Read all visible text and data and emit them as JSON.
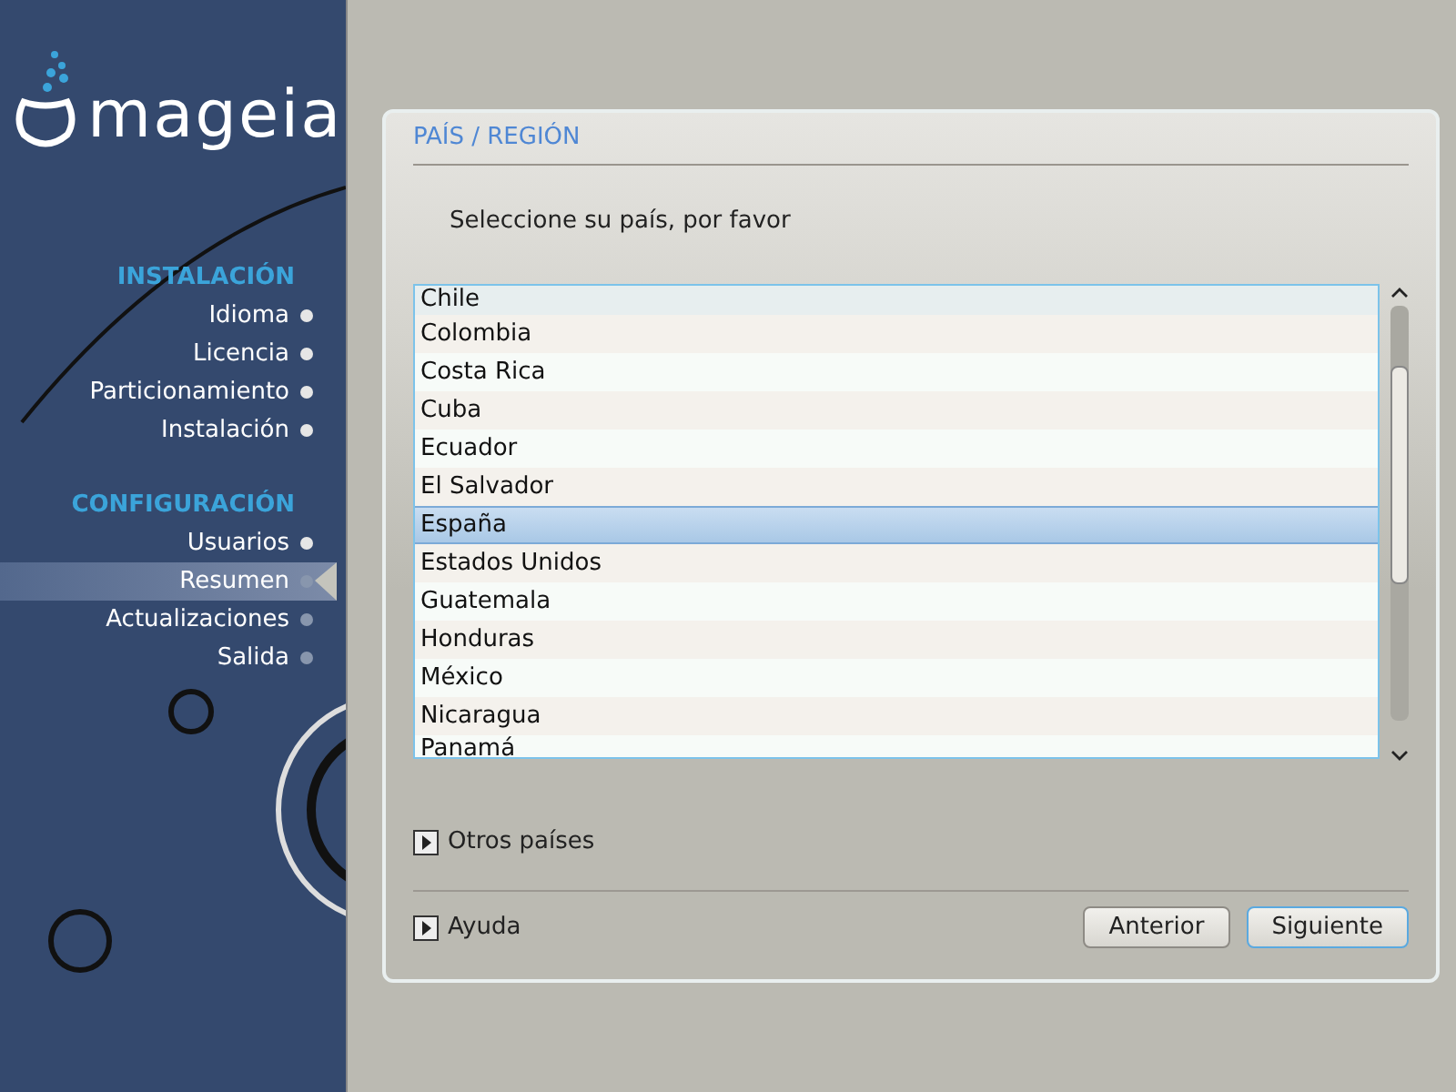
{
  "logo": {
    "text": "mageia"
  },
  "sidebar": {
    "sections": [
      {
        "title": "INSTALACIÓN",
        "items": [
          {
            "label": "Idioma",
            "selected": false,
            "completed": true
          },
          {
            "label": "Licencia",
            "selected": false,
            "completed": true
          },
          {
            "label": "Particionamiento",
            "selected": false,
            "completed": true
          },
          {
            "label": "Instalación",
            "selected": false,
            "completed": true
          }
        ]
      },
      {
        "title": "CONFIGURACIÓN",
        "items": [
          {
            "label": "Usuarios",
            "selected": false,
            "completed": true
          },
          {
            "label": "Resumen",
            "selected": true,
            "completed": false
          },
          {
            "label": "Actualizaciones",
            "selected": false,
            "completed": false
          },
          {
            "label": "Salida",
            "selected": false,
            "completed": false
          }
        ]
      }
    ]
  },
  "panel": {
    "title": "PAÍS / REGIÓN",
    "prompt": "Seleccione su país, por favor",
    "countries": [
      {
        "label": "Chile",
        "selected": false
      },
      {
        "label": "Colombia",
        "selected": false
      },
      {
        "label": "Costa Rica",
        "selected": false
      },
      {
        "label": "Cuba",
        "selected": false
      },
      {
        "label": "Ecuador",
        "selected": false
      },
      {
        "label": "El Salvador",
        "selected": false
      },
      {
        "label": "España",
        "selected": true
      },
      {
        "label": "Estados Unidos",
        "selected": false
      },
      {
        "label": "Guatemala",
        "selected": false
      },
      {
        "label": "Honduras",
        "selected": false
      },
      {
        "label": "México",
        "selected": false
      },
      {
        "label": "Nicaragua",
        "selected": false
      },
      {
        "label": "Panamá",
        "selected": false
      }
    ],
    "expanders": [
      {
        "label": "Otros países",
        "expanded": false
      }
    ],
    "help": {
      "label": "Ayuda",
      "expanded": false
    },
    "buttons": [
      {
        "label": "Anterior",
        "default": false
      },
      {
        "label": "Siguiente",
        "default": true
      }
    ]
  }
}
